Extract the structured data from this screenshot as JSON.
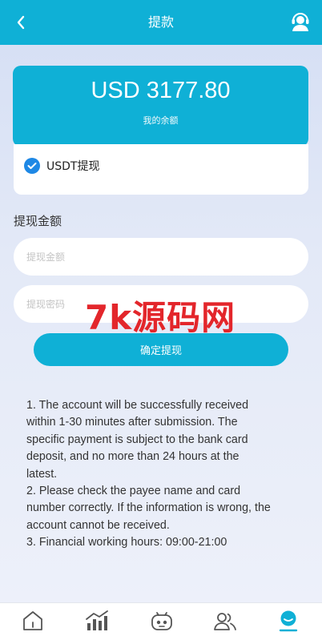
{
  "header": {
    "title": "提款"
  },
  "balance": {
    "amount": "USD 3177.80",
    "label": "我的余额"
  },
  "method": {
    "label": "USDT提现",
    "checked": true
  },
  "form": {
    "section_label": "提现金额",
    "amount_placeholder": "提现金额",
    "password_placeholder": "提现密码",
    "submit_label": "确定提现"
  },
  "watermark": "7k源码网",
  "notes": [
    "1. The account will be successfully received within 1-30 minutes after submission. The specific payment is subject to the bank card deposit, and no more than 24 hours at the latest.",
    "2. Please check the payee name and card number correctly. If the information is wrong, the account cannot be received.",
    "3. Financial working hours: 09:00-21:00"
  ],
  "tabbar": {
    "items": [
      {
        "icon": "home-icon"
      },
      {
        "icon": "chart-icon"
      },
      {
        "icon": "robot-icon"
      },
      {
        "icon": "team-icon"
      },
      {
        "icon": "profile-icon",
        "active": true
      }
    ]
  },
  "colors": {
    "primary": "#0fb0d6",
    "check": "#1e88e5",
    "watermark": "#e3262b"
  }
}
